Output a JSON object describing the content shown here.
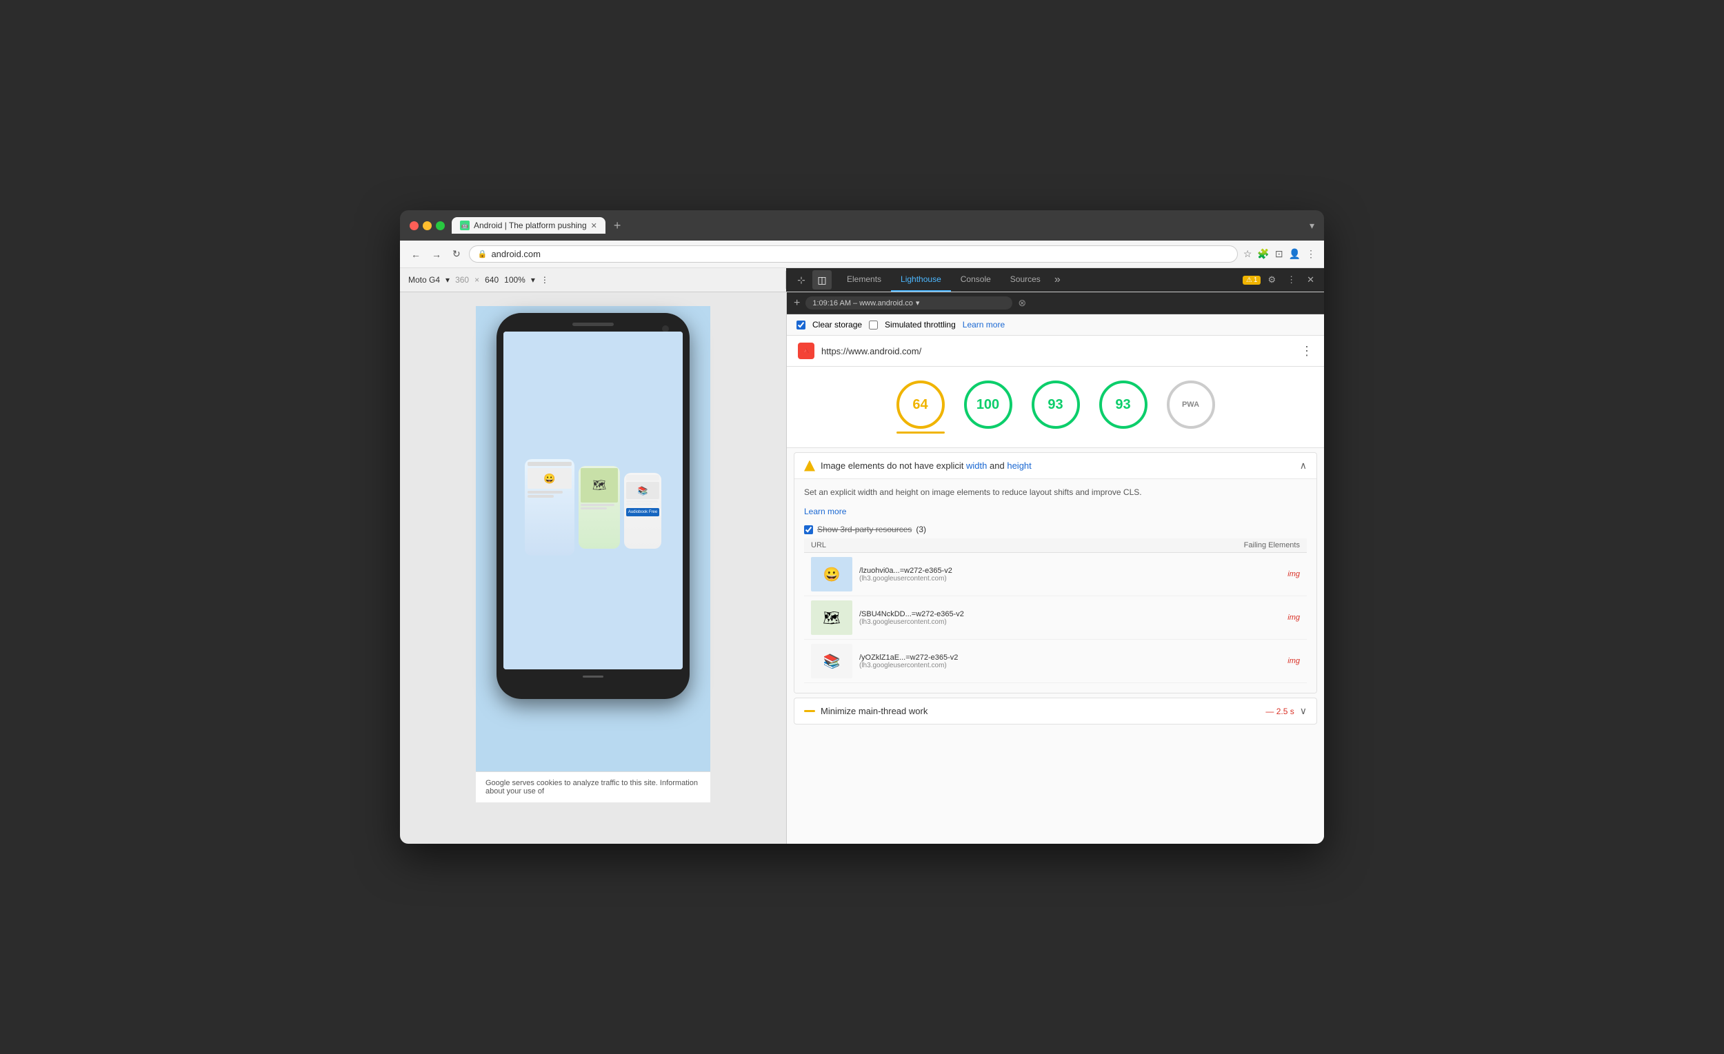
{
  "window": {
    "title": "Browser Window"
  },
  "titleBar": {
    "trafficLights": [
      "red",
      "yellow",
      "green"
    ],
    "tab": {
      "favicon": "🤖",
      "label": "Android | The platform pushing",
      "closeBtn": "✕"
    },
    "newTabBtn": "+",
    "rightControl": "▾"
  },
  "navBar": {
    "backBtn": "←",
    "forwardBtn": "→",
    "reloadBtn": "↻",
    "lockIcon": "🔒",
    "address": "android.com",
    "starIcon": "☆",
    "extensionIcon": "🧩",
    "castIcon": "⊡",
    "profileIcon": "👤",
    "menuIcon": "⋮"
  },
  "devtoolsBar": {
    "viewportDevice": "Moto G4",
    "width": "360",
    "height": "640",
    "zoom": "100%",
    "moreIcon": "⋮",
    "captureIcon": "📷",
    "responsiveIcon": "◫",
    "tabs": [
      "Elements",
      "Lighthouse",
      "Console",
      "Sources"
    ],
    "activeTab": "Lighthouse",
    "moreTabsBtn": "»",
    "warnCount": "1",
    "settingsIcon": "⚙",
    "menuBtn": "⋮",
    "closeBtn": "✕"
  },
  "secondaryBar": {
    "addBtn": "+",
    "urlText": "1:09:16 AM – www.android.co",
    "dropdownIcon": "▾",
    "clearIcon": "⊗"
  },
  "lighthouseOptions": {
    "clearStorageChecked": true,
    "clearStorageLabel": "Clear storage",
    "throttlingChecked": false,
    "throttlingLabel": "Simulated throttling",
    "learnMoreLink": "Learn more"
  },
  "auditHeader": {
    "favicon": "🔺",
    "url": "https://www.android.com/",
    "menuIcon": "⋮"
  },
  "scores": [
    {
      "value": "64",
      "color": "orange",
      "underline": true
    },
    {
      "value": "100",
      "color": "green",
      "underline": false
    },
    {
      "value": "93",
      "color": "green",
      "underline": false
    },
    {
      "value": "93",
      "color": "green",
      "underline": false
    },
    {
      "value": "PWA",
      "color": "gray",
      "underline": false
    }
  ],
  "audit": {
    "title": "Image elements do not have explicit",
    "keyword1": "width",
    "between": "and",
    "keyword2": "height",
    "description": "Set an explicit width and height on image elements to reduce layout shifts and improve CLS.",
    "learnMoreLink": "Learn more",
    "show3rdParty": true,
    "show3rdPartyLabel": "Show 3rd-party resources",
    "show3rdPartyCount": "(3)",
    "tableHeaders": {
      "url": "URL",
      "failingElements": "Failing Elements"
    },
    "resources": [
      {
        "urlPath": "/lzuohvi0a...=w272-e365-v2",
        "urlHost": "(lh3.googleusercontent.com)",
        "failElement": "img",
        "thumbColor": "#c8e0f5"
      },
      {
        "urlPath": "/SBU4NckDD...=w272-e365-v2",
        "urlHost": "(lh3.googleusercontent.com)",
        "failElement": "img",
        "thumbColor": "#e0eed8"
      },
      {
        "urlPath": "/yOZklZ1aE...=w272-e365-v2",
        "urlHost": "(lh3.googleusercontent.com)",
        "failElement": "img",
        "thumbColor": "#f5f5f5"
      }
    ]
  },
  "collapsedAudit": {
    "title": "Minimize main-thread work",
    "timeValue": "— 2.5 s",
    "chevron": "∨"
  },
  "browserContent": {
    "cookieText": "Google serves cookies to analyze traffic to this site. Information about your use of"
  }
}
